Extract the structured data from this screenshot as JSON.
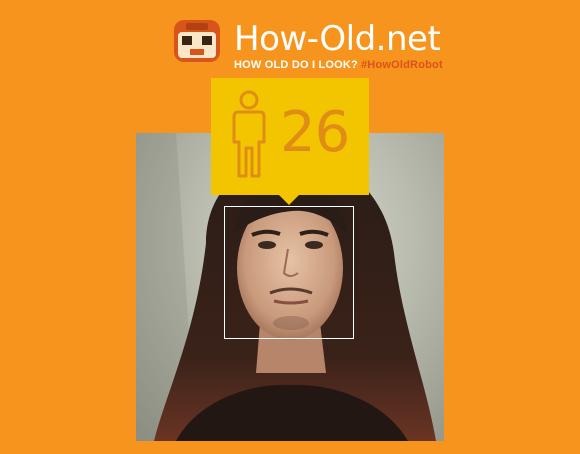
{
  "header": {
    "logo_icon": "robot-face-icon",
    "title": "How-Old.net",
    "question": "HOW OLD DO I LOOK?",
    "hashtag": "#HowOldRobot"
  },
  "result": {
    "gender_icon": "male-person-icon",
    "age": "26"
  },
  "colors": {
    "background": "#f7941d",
    "badge": "#f2c500",
    "age_text": "#e08d16",
    "hashtag": "#d7541a"
  }
}
